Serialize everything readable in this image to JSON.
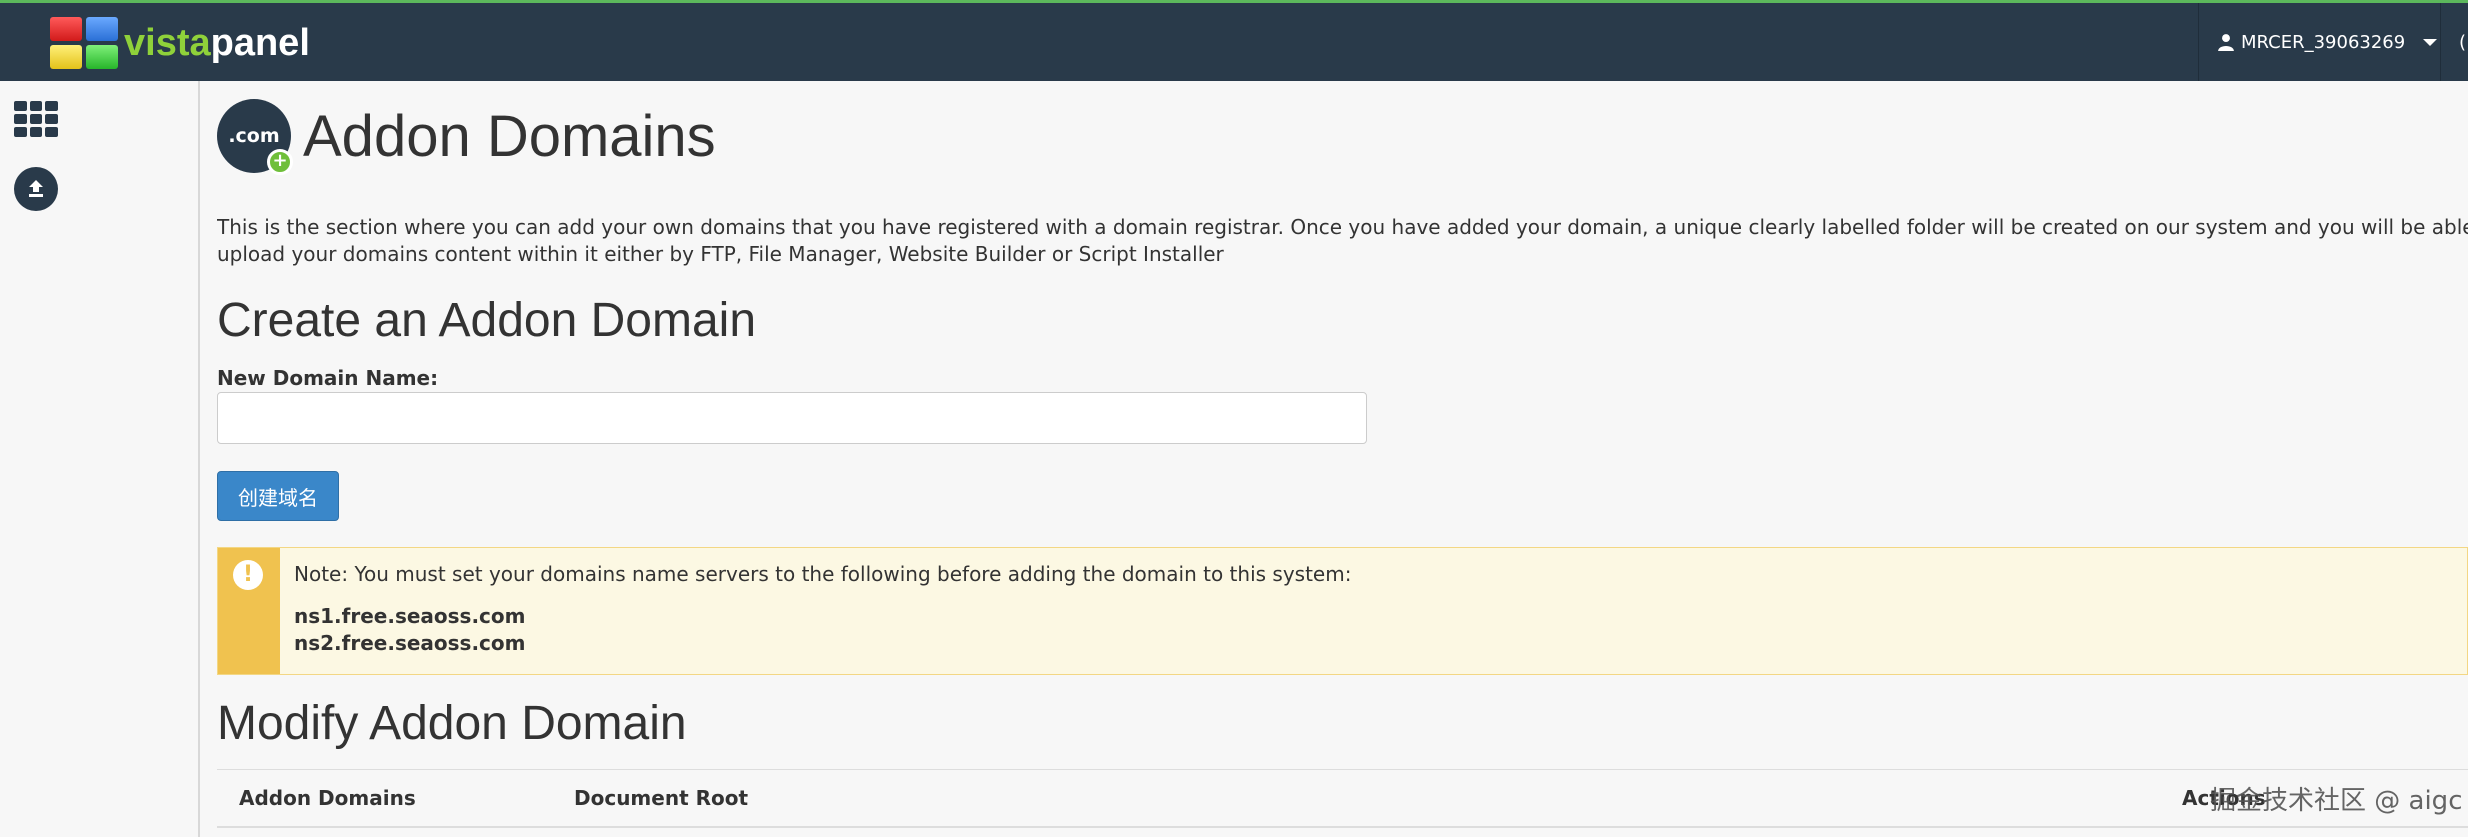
{
  "brand": {
    "logo_text_1": "vista",
    "logo_text_2": "panel",
    "colors": {
      "topbar": "#293a4a",
      "accent_green": "#8fd13a",
      "button_blue": "#3a87c9",
      "alert_yellow": "#f0c24f"
    }
  },
  "header": {
    "username": "MRCER_39063269",
    "cut_off_text": "("
  },
  "sidebar": {
    "icons": [
      "apps-grid-icon",
      "upload-icon"
    ]
  },
  "main": {
    "page_icon_text": ".com",
    "page_icon_plus": "+",
    "title": "Addon Domains",
    "description": "This is the section where you can add your own domains that you have registered with a domain registrar. Once you have added your domain, a unique clearly labelled folder will be created on our system and you will be able to upload your domains content within it either by FTP, File Manager, Website Builder or Script Installer",
    "create_heading": "Create an Addon Domain",
    "new_domain_label": "New Domain Name:",
    "new_domain_value": "",
    "create_button": "创建域名",
    "alert": {
      "icon": "!",
      "note": "Note: You must set your domains name servers to the following before adding the domain to this system:",
      "ns1": "ns1.free.seaoss.com",
      "ns2": "ns2.free.seaoss.com"
    },
    "modify_heading": "Modify Addon Domain",
    "table": {
      "columns": [
        "Addon Domains",
        "Document Root",
        "Actions"
      ]
    }
  },
  "watermark": "掘金技术社区 @ aigc"
}
